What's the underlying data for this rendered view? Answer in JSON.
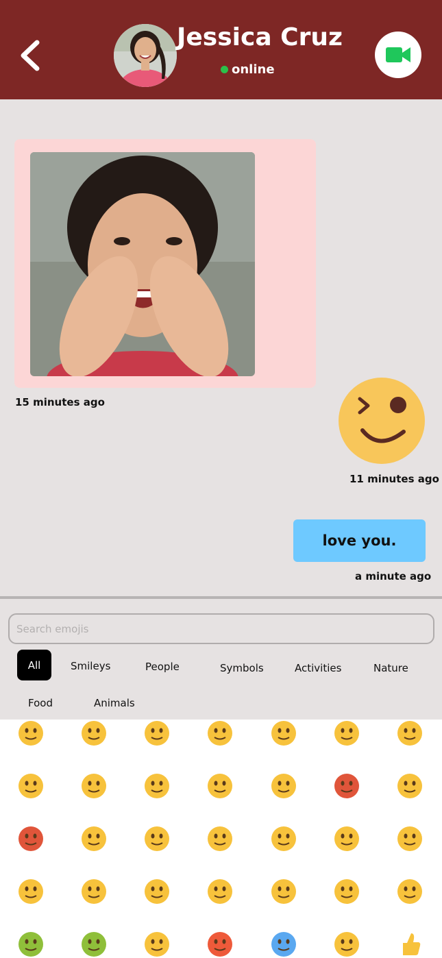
{
  "header": {
    "contact_name": "Jessica Cruz",
    "status": "online",
    "back_icon": "chevron-left-icon",
    "video_icon": "video-camera-icon",
    "colors": {
      "bar": "#7e2725",
      "online": "#2bc04a",
      "video": "#1fc75b"
    }
  },
  "messages": [
    {
      "type": "image",
      "from": "contact",
      "time": "15 minutes ago",
      "bubble_color": "#fcd6d6"
    },
    {
      "type": "sticker",
      "from": "me",
      "sticker": "winking-smiley",
      "time": "11 minutes ago"
    },
    {
      "type": "text",
      "from": "me",
      "text": "love you.",
      "time": "a minute ago",
      "bubble_color": "#6ec9ff"
    }
  ],
  "emoji_picker": {
    "search_placeholder": "Search emojis",
    "categories": [
      "All",
      "Smileys",
      "People",
      "Symbols",
      "Activities",
      "Nature",
      "Food",
      "Animals"
    ],
    "active_category": "All",
    "emojis": [
      [
        "😎",
        "🤩",
        "😏",
        "😬",
        "😮",
        "😲",
        "😳"
      ],
      [
        "🥲",
        "😭",
        "😢",
        "😅",
        "😤",
        "😡",
        "😠"
      ],
      [
        "🤬",
        "😱",
        "😨",
        "😴",
        "🤤",
        "🤗",
        "🤔"
      ],
      [
        "🤫",
        "🤭",
        "🙄",
        "🥱",
        "🥳",
        "🤒",
        "🤕"
      ],
      [
        "🤢",
        "🤮",
        "🤧",
        "🥵",
        "🥶",
        "😵",
        "👍"
      ]
    ]
  }
}
